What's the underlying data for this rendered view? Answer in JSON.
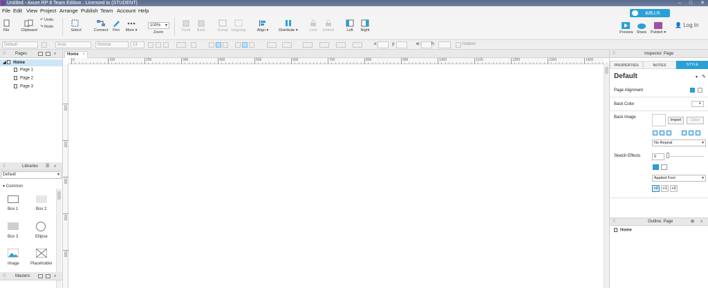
{
  "window": {
    "title": "Untitled - Axure RP 8 Team Edition : Licensed to      (STUDENT)"
  },
  "menu": [
    "File",
    "Edit",
    "View",
    "Project",
    "Arrange",
    "Publish",
    "Team",
    "Account",
    "Help"
  ],
  "toolbar": {
    "file": "File",
    "clipboard": "Clipboard",
    "undo": "Undo",
    "redo": "Redo",
    "select": "Select",
    "connect": "Connect",
    "pen": "Pen",
    "more": "More ▾",
    "zoom_value": "100%",
    "zoom_label": "Zoom",
    "front": "Front",
    "back": "Back",
    "group": "Group",
    "ungroup": "Ungroup",
    "align": "Align ▾",
    "distribute": "Distribute ▾",
    "lock": "Lock",
    "unlock": "Unlock",
    "left": "Left",
    "right": "Right",
    "preview": "Preview",
    "share": "Share",
    "publish": "Publish ▾",
    "login": "Log In",
    "cloud_button": "拍照上传"
  },
  "format": {
    "style": "Default",
    "font": "Arial",
    "weight": "Normal",
    "size": "13",
    "x_label": "x:",
    "y_label": "y:",
    "w_label": "w:",
    "h_label": "h:",
    "hidden": "Hidden"
  },
  "pages": {
    "title": "Pages",
    "items": [
      "Home",
      "Page 1",
      "Page 2",
      "Page 3"
    ]
  },
  "libraries": {
    "title": "Libraries",
    "selected": "Default",
    "group": "Common",
    "widgets": [
      "Box 1",
      "Box 2",
      "Box 3",
      "Ellipse",
      "Image",
      "Placeholder"
    ]
  },
  "masters": {
    "title": "Masters"
  },
  "canvas": {
    "tab": "Home",
    "h_ticks": [
      "0",
      "100",
      "200",
      "300",
      "400",
      "500",
      "600",
      "700",
      "800",
      "900",
      "1000",
      "1100",
      "1200",
      "1300",
      "1400"
    ],
    "v_ticks": [
      "100",
      "200",
      "300",
      "400",
      "500"
    ]
  },
  "inspector": {
    "title": "Inspector: Page",
    "tabs": [
      "PROPERTIES",
      "NOTES",
      "STYLE"
    ],
    "style_name": "Default",
    "page_alignment": "Page Alignment",
    "back_color": "Back Color",
    "back_image": "Back Image",
    "import": "Import",
    "clear": "Clear",
    "repeat": "No Repeat",
    "sketch": "Sketch Effects",
    "sketch_value": "0",
    "applied_font": "Applied Font",
    "font_buttons": [
      "+0",
      "+1",
      "+2"
    ]
  },
  "outline": {
    "title": "Outline: Page",
    "item": "Home"
  },
  "colors": {
    "accent": "#2a9fd8",
    "title_bar": "#5a6a8a"
  }
}
